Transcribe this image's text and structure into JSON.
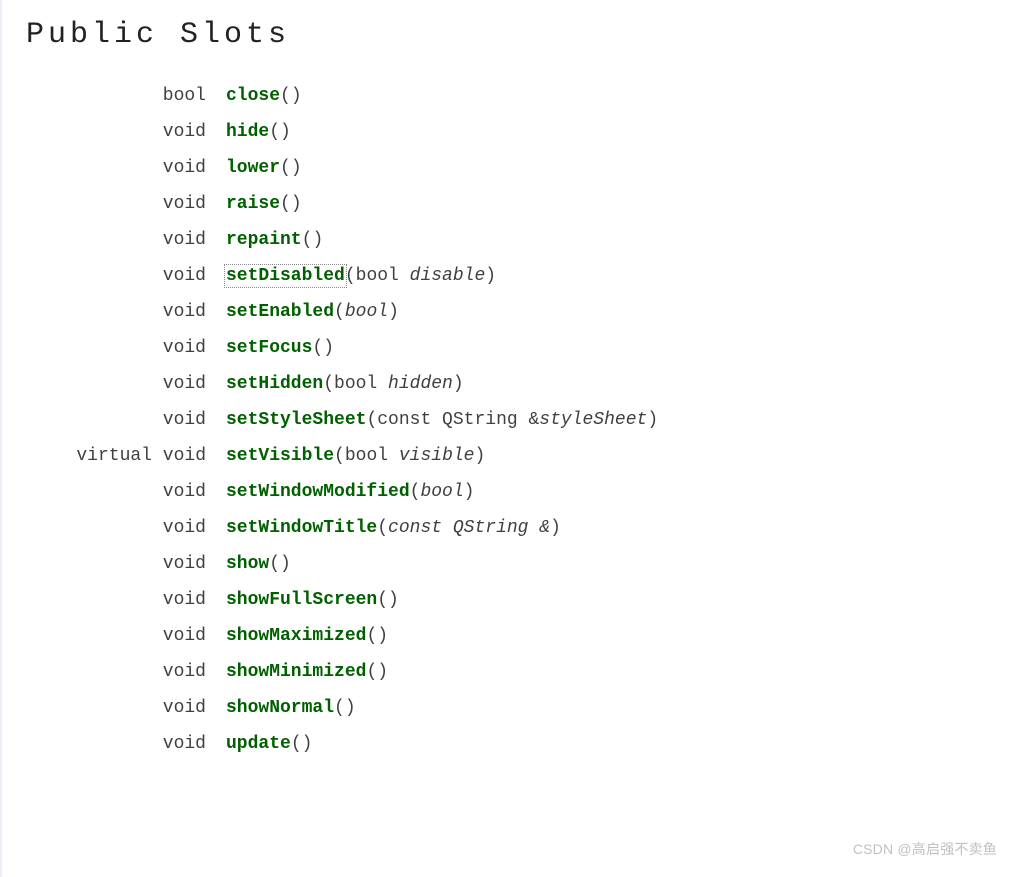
{
  "section_title": "Public Slots",
  "slots": [
    {
      "ret": "bool",
      "fn": "close",
      "params": [],
      "boxed": false
    },
    {
      "ret": "void",
      "fn": "hide",
      "params": [],
      "boxed": false
    },
    {
      "ret": "void",
      "fn": "lower",
      "params": [],
      "boxed": false
    },
    {
      "ret": "void",
      "fn": "raise",
      "params": [],
      "boxed": false
    },
    {
      "ret": "void",
      "fn": "repaint",
      "params": [],
      "boxed": false
    },
    {
      "ret": "void",
      "fn": "setDisabled",
      "params": [
        {
          "t": "plain",
          "v": "bool "
        },
        {
          "t": "ital",
          "v": "disable"
        }
      ],
      "boxed": true
    },
    {
      "ret": "void",
      "fn": "setEnabled",
      "params": [
        {
          "t": "ital",
          "v": "bool"
        }
      ],
      "boxed": false
    },
    {
      "ret": "void",
      "fn": "setFocus",
      "params": [],
      "boxed": false
    },
    {
      "ret": "void",
      "fn": "setHidden",
      "params": [
        {
          "t": "plain",
          "v": "bool "
        },
        {
          "t": "ital",
          "v": "hidden"
        }
      ],
      "boxed": false
    },
    {
      "ret": "void",
      "fn": "setStyleSheet",
      "params": [
        {
          "t": "plain",
          "v": "const QString &"
        },
        {
          "t": "ital",
          "v": "styleSheet"
        }
      ],
      "boxed": false
    },
    {
      "ret": "virtual void",
      "fn": "setVisible",
      "params": [
        {
          "t": "plain",
          "v": "bool "
        },
        {
          "t": "ital",
          "v": "visible"
        }
      ],
      "boxed": false
    },
    {
      "ret": "void",
      "fn": "setWindowModified",
      "params": [
        {
          "t": "ital",
          "v": "bool"
        }
      ],
      "boxed": false
    },
    {
      "ret": "void",
      "fn": "setWindowTitle",
      "params": [
        {
          "t": "ital",
          "v": "const QString &"
        }
      ],
      "boxed": false
    },
    {
      "ret": "void",
      "fn": "show",
      "params": [],
      "boxed": false
    },
    {
      "ret": "void",
      "fn": "showFullScreen",
      "params": [],
      "boxed": false
    },
    {
      "ret": "void",
      "fn": "showMaximized",
      "params": [],
      "boxed": false
    },
    {
      "ret": "void",
      "fn": "showMinimized",
      "params": [],
      "boxed": false
    },
    {
      "ret": "void",
      "fn": "showNormal",
      "params": [],
      "boxed": false
    },
    {
      "ret": "void",
      "fn": "update",
      "params": [],
      "boxed": false
    }
  ],
  "watermark": "CSDN @高启强不卖鱼"
}
